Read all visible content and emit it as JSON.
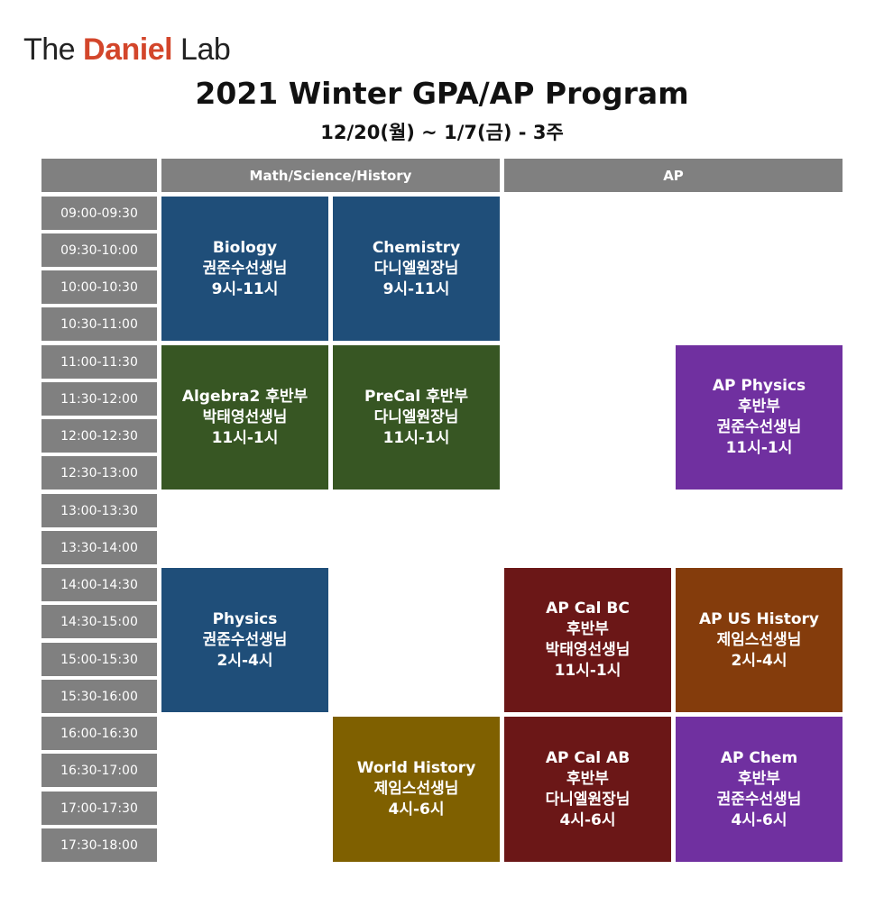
{
  "logo": {
    "pre": "The ",
    "brand": "Daniel",
    "post": " Lab"
  },
  "title": "2021 Winter GPA/AP Program",
  "subtitle": "12/20(월) ~ 1/7(금) - 3주",
  "headers": {
    "math": "Math/Science/History",
    "ap": "AP"
  },
  "slots": [
    "09:00-09:30",
    "09:30-10:00",
    "10:00-10:30",
    "10:30-11:00",
    "11:00-11:30",
    "11:30-12:00",
    "12:00-12:30",
    "12:30-13:00",
    "13:00-13:30",
    "13:30-14:00",
    "14:00-14:30",
    "14:30-15:00",
    "15:00-15:30",
    "15:30-16:00",
    "16:00-16:30",
    "16:30-17:00",
    "17:00-17:30",
    "17:30-18:00"
  ],
  "classes": {
    "biology": {
      "name": "Biology",
      "teacher": "권준수선생님",
      "time": "9시-11시"
    },
    "chemistry": {
      "name": "Chemistry",
      "teacher": "다니엘원장님",
      "time": "9시-11시"
    },
    "algebra2": {
      "name": "Algebra2 후반부",
      "teacher": "박태영선생님",
      "time": "11시-1시"
    },
    "precal": {
      "name": "PreCal 후반부",
      "teacher": "다니엘원장님",
      "time": "11시-1시"
    },
    "ap_physics": {
      "name": "AP Physics",
      "sub": "후반부",
      "teacher": "권준수선생님",
      "time": "11시-1시"
    },
    "physics": {
      "name": "Physics",
      "teacher": "권준수선생님",
      "time": "2시-4시"
    },
    "ap_cal_bc": {
      "name": "AP Cal BC",
      "sub": "후반부",
      "teacher": "박태영선생님",
      "time": "11시-1시"
    },
    "ap_us_history": {
      "name": "AP US History",
      "teacher": "제임스선생님",
      "time": "2시-4시"
    },
    "world_history": {
      "name": "World History",
      "teacher": "제임스선생님",
      "time": "4시-6시"
    },
    "ap_cal_ab": {
      "name": "AP Cal AB",
      "sub": "후반부",
      "teacher": "다니엘원장님",
      "time": "4시-6시"
    },
    "ap_chem": {
      "name": "AP Chem",
      "sub": "후반부",
      "teacher": "권준수선생님",
      "time": "4시-6시"
    }
  },
  "colors": {
    "header": "#808080",
    "blue": "#1f4e79",
    "green": "#375623",
    "purple": "#7030a0",
    "maroon": "#6b1717",
    "orange": "#843c0c",
    "olive": "#7f6000",
    "logo_brand": "#d3462b"
  }
}
